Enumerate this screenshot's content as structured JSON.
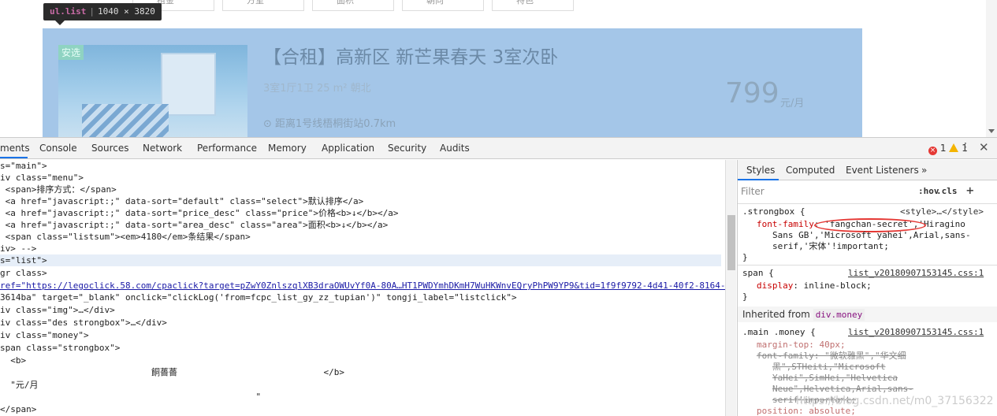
{
  "page": {
    "filters": [
      "租金",
      "方室",
      "面积",
      "朝向",
      "特色"
    ],
    "tooltip": {
      "tag": "ul.list",
      "size": "1040 × 3820"
    },
    "listing": {
      "badge": "安选",
      "title": "【合租】高新区 新芒果春天 3室次卧",
      "room": "3室1厅1卫    25 m²  朝北",
      "address": "距离1号线梧桐街站0.7km",
      "price": "799",
      "unit": "元/月"
    }
  },
  "devtools": {
    "tabs": [
      "ments",
      "Console",
      "Sources",
      "Network",
      "Performance",
      "Memory",
      "Application",
      "Security",
      "Audits"
    ],
    "errors": "1",
    "warnings": "1",
    "dom_lines": [
      "s=\"main\">",
      "iv class=\"menu\">",
      " <span>排序方式：</span>",
      " <a href=\"javascript:;\" data-sort=\"default\" class=\"select\">默认排序</a>",
      " <a href=\"javascript:;\" data-sort=\"price_desc\" class=\"price\">价格<b>↓</b></a>",
      " <a href=\"javascript:;\" data-sort=\"area_desc\" class=\"area\">面积<b>↓</b></a>",
      " <span class=\"listsum\"><em>4180</em>条结果</span>",
      "iv> -->",
      "s=\"list\">",
      "gr class>",
      "ref=\"https://legoclick.58.com/cpaclick?target=pZwY0ZnlszqlXB3draOWUvYf0A-80A…HT1PWDYmhDKmH7WuHKWnvEQryPhPW9YP9&tid=1f9f9792-4d41-40f2-8164-",
      "3614ba\" target=\"_blank\" onclick=\"clickLog('from=fcpc_list_gy_zz_tupian')\" tongji_label=\"listclick\">",
      "iv class=\"img\">…</div>",
      "iv class=\"des strongbox\">…</div>",
      "iv class=\"money\">",
      "span class=\"strongbox\">",
      "  <b>",
      "                             餇薔薔                            </b>",
      "  \"元/月",
      "                                                 \"",
      "</span>"
    ],
    "styles": {
      "tabs": [
        "Styles",
        "Computed",
        "Event Listeners",
        "»"
      ],
      "filter_placeholder": "Filter",
      "hov": ":hov",
      "cls": ".cls",
      "plus": "+",
      "rule1": {
        "selector": ".strongbox {",
        "source": "<style>…</style>",
        "prop": "font-family",
        "val1": "'fangchan-secret'",
        "val2": ",'Hiragino",
        "val3": "Sans GB','Microsoft yahei',Arial,sans-",
        "val4": "serif,'宋体'!important;",
        "close": "}"
      },
      "rule2": {
        "selector": "span {",
        "source": "list_v20180907153145.css:1",
        "prop": "display",
        "val": "inline-block;",
        "close": "}"
      },
      "inherited_label": "Inherited from",
      "inherited_chip": "div.money",
      "rule3": {
        "selector": ".main .money {",
        "source": "list_v20180907153145.css:1",
        "l1": "margin-top: 40px;",
        "l2": "font-family: \"微软雅黑\",\"华文细",
        "l3": "黑\",STHeiti,\"Microsoft",
        "l4": "YaHei\",SimHei,\"Helvetica",
        "l5": "Neue\",Helvetica,Arial,sans-",
        "l6": "serif!important;",
        "l7": "position: absolute;"
      }
    },
    "watermark": "https://blog.csdn.net/m0_37156322"
  }
}
